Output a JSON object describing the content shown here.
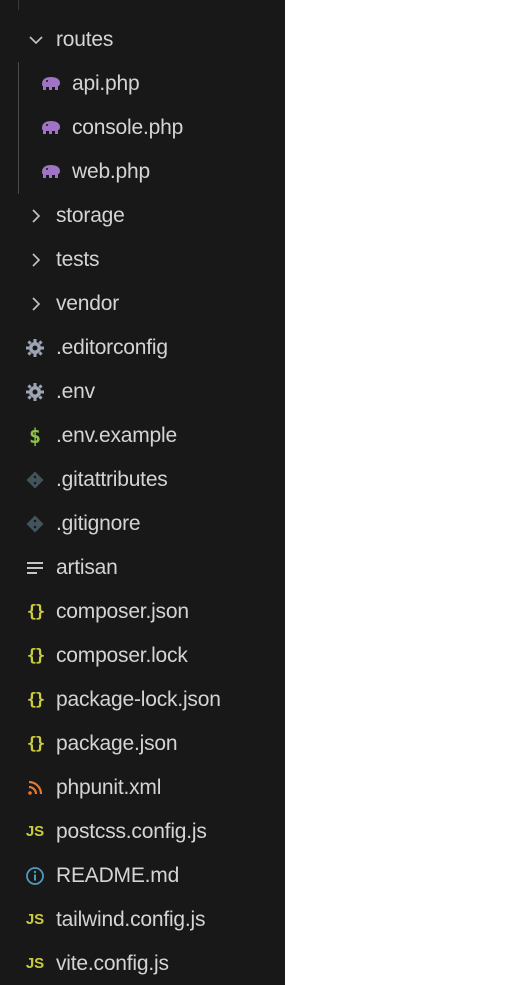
{
  "tree": {
    "routes": {
      "label": "routes",
      "expanded": true,
      "children": [
        {
          "label": "api.php",
          "icon": "php-elephant-icon"
        },
        {
          "label": "console.php",
          "icon": "php-elephant-icon"
        },
        {
          "label": "web.php",
          "icon": "php-elephant-icon"
        }
      ]
    },
    "folders": [
      {
        "label": "storage",
        "expanded": false
      },
      {
        "label": "tests",
        "expanded": false
      },
      {
        "label": "vendor",
        "expanded": false
      }
    ],
    "files": [
      {
        "label": ".editorconfig",
        "icon": "gear-icon"
      },
      {
        "label": ".env",
        "icon": "gear-icon"
      },
      {
        "label": ".env.example",
        "icon": "dollar-icon"
      },
      {
        "label": ".gitattributes",
        "icon": "git-diamond-icon"
      },
      {
        "label": ".gitignore",
        "icon": "git-diamond-icon"
      },
      {
        "label": "artisan",
        "icon": "text-lines-icon"
      },
      {
        "label": "composer.json",
        "icon": "json-braces-icon"
      },
      {
        "label": "composer.lock",
        "icon": "json-braces-icon"
      },
      {
        "label": "package-lock.json",
        "icon": "json-braces-icon"
      },
      {
        "label": "package.json",
        "icon": "json-braces-icon"
      },
      {
        "label": "phpunit.xml",
        "icon": "rss-icon"
      },
      {
        "label": "postcss.config.js",
        "icon": "js-icon"
      },
      {
        "label": "README.md",
        "icon": "info-icon"
      },
      {
        "label": "tailwind.config.js",
        "icon": "js-icon"
      },
      {
        "label": "vite.config.js",
        "icon": "js-icon"
      }
    ]
  },
  "colors": {
    "background": "#181818",
    "text": "#d4d4d4",
    "php": "#a074c4",
    "json": "#cbcb41",
    "dollar": "#8dc149",
    "gear": "#9da5b4",
    "git": "#41535b",
    "rss": "#e37933",
    "js": "#cbcb41",
    "info": "#519aba"
  }
}
